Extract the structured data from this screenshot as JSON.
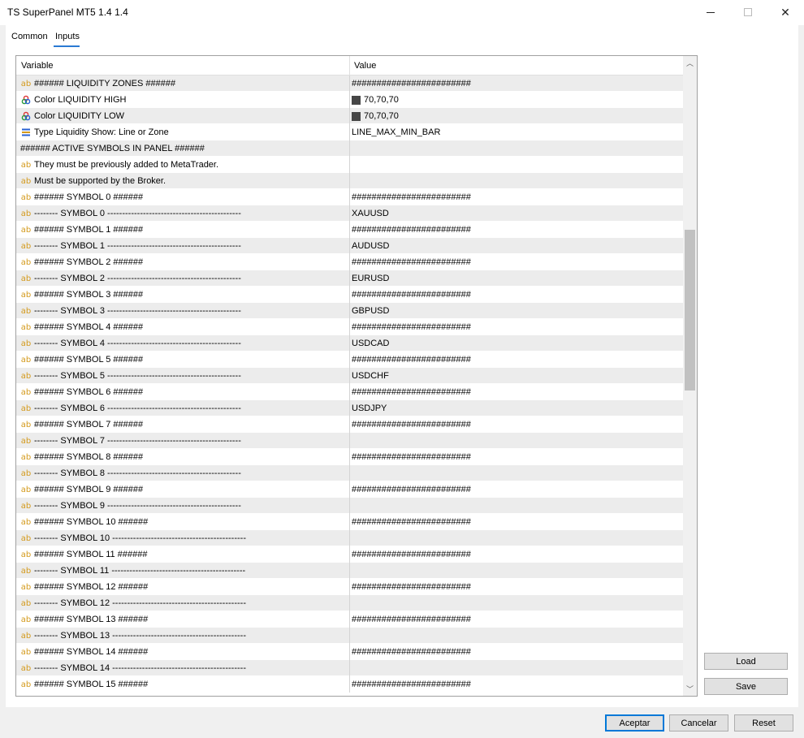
{
  "window": {
    "title": "TS SuperPanel MT5 1.4 1.4",
    "minimize_glyph": "",
    "maximize_glyph": "",
    "close_glyph": "✕"
  },
  "tabs": [
    {
      "label": "Common"
    },
    {
      "label": "Inputs"
    }
  ],
  "grid": {
    "headers": {
      "variable": "Variable",
      "value": "Value"
    },
    "rows": [
      {
        "icon": "ab",
        "variable": "###### LIQUIDITY ZONES ######",
        "value": "########################"
      },
      {
        "icon": "color",
        "variable": "Color LIQUIDITY HIGH",
        "value": "70,70,70",
        "swatch": "#464646"
      },
      {
        "icon": "color",
        "variable": "Color LIQUIDITY LOW",
        "value": "70,70,70",
        "swatch": "#464646"
      },
      {
        "icon": "enum",
        "variable": "Type Liquidity Show: Line or Zone",
        "value": "LINE_MAX_MIN_BAR"
      },
      {
        "icon": "none",
        "variable": "###### ACTIVE SYMBOLS IN PANEL ######",
        "value": ""
      },
      {
        "icon": "ab",
        "variable": "They must be previously added to MetaTrader.",
        "value": ""
      },
      {
        "icon": "ab",
        "variable": "Must be supported by the Broker.",
        "value": ""
      },
      {
        "icon": "ab",
        "variable": "###### SYMBOL 0 ######",
        "value": "########################"
      },
      {
        "icon": "ab",
        "variable": "-------- SYMBOL 0 ---------------------------------------------",
        "value": "XAUUSD"
      },
      {
        "icon": "ab",
        "variable": "###### SYMBOL 1 ######",
        "value": "########################"
      },
      {
        "icon": "ab",
        "variable": "-------- SYMBOL 1 ---------------------------------------------",
        "value": "AUDUSD"
      },
      {
        "icon": "ab",
        "variable": "###### SYMBOL 2 ######",
        "value": "########################"
      },
      {
        "icon": "ab",
        "variable": "-------- SYMBOL 2 ---------------------------------------------",
        "value": "EURUSD"
      },
      {
        "icon": "ab",
        "variable": "###### SYMBOL 3 ######",
        "value": "########################"
      },
      {
        "icon": "ab",
        "variable": "-------- SYMBOL 3 ---------------------------------------------",
        "value": "GBPUSD"
      },
      {
        "icon": "ab",
        "variable": "###### SYMBOL 4 ######",
        "value": "########################"
      },
      {
        "icon": "ab",
        "variable": "-------- SYMBOL 4 ---------------------------------------------",
        "value": "USDCAD"
      },
      {
        "icon": "ab",
        "variable": "###### SYMBOL 5 ######",
        "value": "########################"
      },
      {
        "icon": "ab",
        "variable": "-------- SYMBOL 5 ---------------------------------------------",
        "value": "USDCHF"
      },
      {
        "icon": "ab",
        "variable": "###### SYMBOL 6 ######",
        "value": "########################"
      },
      {
        "icon": "ab",
        "variable": "-------- SYMBOL 6 ---------------------------------------------",
        "value": "USDJPY"
      },
      {
        "icon": "ab",
        "variable": "###### SYMBOL 7 ######",
        "value": "########################"
      },
      {
        "icon": "ab",
        "variable": "-------- SYMBOL 7 ---------------------------------------------",
        "value": ""
      },
      {
        "icon": "ab",
        "variable": "###### SYMBOL 8 ######",
        "value": "########################"
      },
      {
        "icon": "ab",
        "variable": "-------- SYMBOL 8 ---------------------------------------------",
        "value": ""
      },
      {
        "icon": "ab",
        "variable": "###### SYMBOL 9 ######",
        "value": "########################"
      },
      {
        "icon": "ab",
        "variable": "-------- SYMBOL 9 ---------------------------------------------",
        "value": ""
      },
      {
        "icon": "ab",
        "variable": "###### SYMBOL 10 ######",
        "value": "########################"
      },
      {
        "icon": "ab",
        "variable": "-------- SYMBOL 10 ---------------------------------------------",
        "value": ""
      },
      {
        "icon": "ab",
        "variable": "###### SYMBOL 11 ######",
        "value": "########################"
      },
      {
        "icon": "ab",
        "variable": "-------- SYMBOL 11 ---------------------------------------------",
        "value": ""
      },
      {
        "icon": "ab",
        "variable": "###### SYMBOL 12 ######",
        "value": "########################"
      },
      {
        "icon": "ab",
        "variable": "-------- SYMBOL 12 ---------------------------------------------",
        "value": ""
      },
      {
        "icon": "ab",
        "variable": "###### SYMBOL 13 ######",
        "value": "########################"
      },
      {
        "icon": "ab",
        "variable": "-------- SYMBOL 13 ---------------------------------------------",
        "value": ""
      },
      {
        "icon": "ab",
        "variable": "###### SYMBOL 14 ######",
        "value": "########################"
      },
      {
        "icon": "ab",
        "variable": "-------- SYMBOL 14 ---------------------------------------------",
        "value": ""
      },
      {
        "icon": "ab",
        "variable": "###### SYMBOL 15 ######",
        "value": "########################"
      }
    ]
  },
  "scrollbar": {
    "up_glyph": "︿",
    "down_glyph": "﹀"
  },
  "side_buttons": {
    "load": "Load",
    "save": "Save"
  },
  "footer_buttons": {
    "accept": "Aceptar",
    "cancel": "Cancelar",
    "reset": "Reset"
  },
  "colors": {
    "accent": "#0078d7",
    "row_alt": "#ececec",
    "ab_icon": "#d49a1c"
  }
}
